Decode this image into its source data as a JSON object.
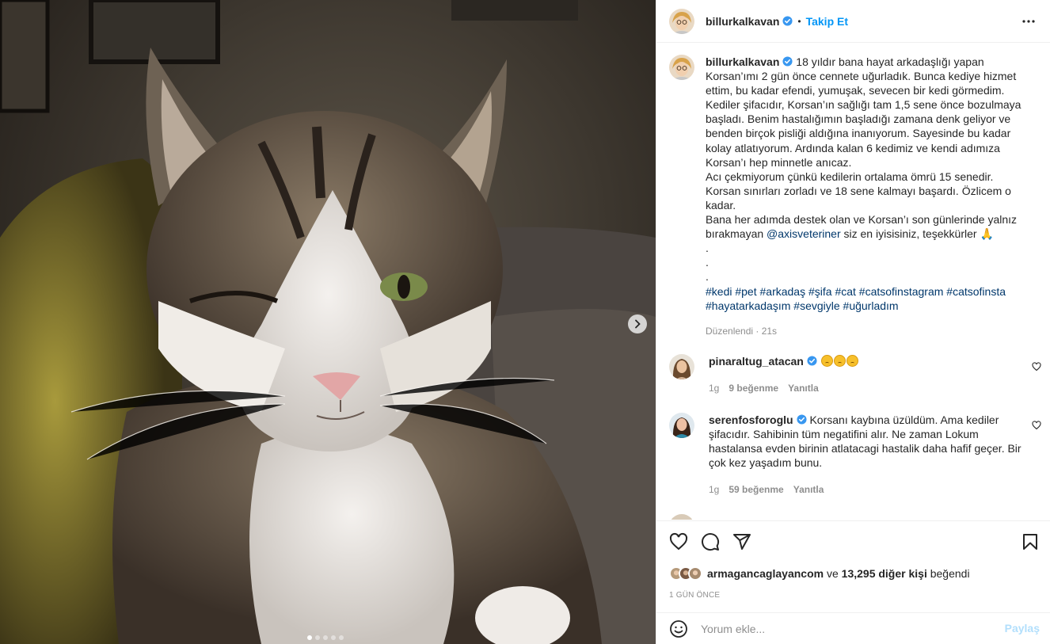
{
  "author": {
    "username": "billurkalkavan",
    "follow_label": "Takip Et",
    "separator": "•"
  },
  "caption": {
    "text": "18 yıldır bana hayat arkadaşlığı yapan Korsan’ımı 2 gün önce cennete uğurladık. Bunca kediye hizmet ettim, bu kadar efendi, yumuşak, sevecen bir kedi görmedim. Kediler şifacıdır, Korsan’ın sağlığı tam 1,5 sene önce bozulmaya başladı. Benim hastalığımın başladığı zamana denk geliyor ve benden birçok pisliği aldığına inanıyorum. Sayesinde bu kadar kolay atlatıyorum. Ardında kalan 6 kedimiz ve kendi adımıza Korsan’ı hep minnetle anıcaz.\nAcı çekmiyorum çünkü kedilerin ortalama ömrü 15 senedir. Korsan sınırları zorladı ve 18 sene kalmayı başardı. Özlicem o kadar.\nBana her adımda destek olan ve Korsan’ı son günlerinde yalnız bırakmayan ",
    "mention": "@axisveteriner",
    "text_after": " siz en iyisisiniz, teşekkürler 🙏",
    "dots": ".\n.\n.",
    "hashtags": "#kedi #pet #arkadaş #şifa #cat #catsofinstagram #catsofinsta #hayatarkadaşım #sevgiyle #uğurladım",
    "edited_time": "Düzenlendi · 21s"
  },
  "comments": [
    {
      "username": "pinaraltug_atacan",
      "text": "",
      "time": "1g",
      "likes": "9 beğenme",
      "reply": "Yanıtla"
    },
    {
      "username": "serenfosforoglu",
      "text": "Korsanı kaybına üzüldüm. Ama kediler şifacıdır. Sahibinin tüm negatifini alır. Ne zaman Lokum hastalansa evden birinin atlatacagi hastalik daha hafif geçer. Bir çok kez yaşadım bunu.",
      "time": "1g",
      "likes": "59 beğenme",
      "reply": "Yanıtla"
    }
  ],
  "likes": {
    "liker": "armagancaglayancom",
    "conjunction": " ve ",
    "others": "13,295 diğer kişi",
    "suffix": " beğendi"
  },
  "post_date": "1 GÜN ÖNCE",
  "comment_box": {
    "placeholder": "Yorum ekle...",
    "submit_label": "Paylaş"
  },
  "carousel": {
    "count": 5,
    "active": 1
  },
  "colors": {
    "accent": "#0095f6",
    "link": "#00376b",
    "muted": "#8e8e8e",
    "verified": "#3897f0"
  }
}
